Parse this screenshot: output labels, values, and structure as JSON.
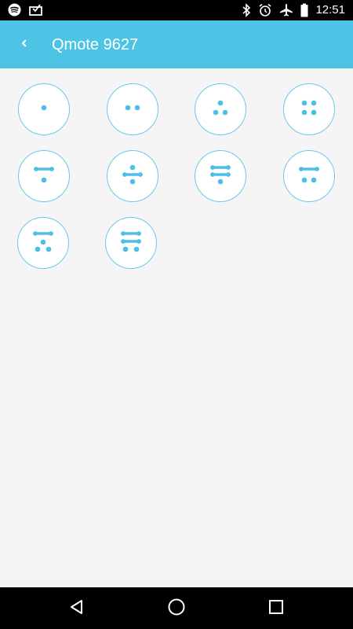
{
  "status_bar": {
    "time": "12:51",
    "left_icons": [
      "spotify-icon",
      "inbox-check-icon"
    ],
    "right_icons": [
      "bluetooth-icon",
      "alarm-icon",
      "airplane-mode-icon",
      "battery-icon"
    ]
  },
  "app_bar": {
    "title": "Qmote 9627",
    "back_icon": "chevron-left-icon"
  },
  "colors": {
    "status_bar": "#000000",
    "app_bar": "#4dc3e6",
    "accent": "#4dbfe6",
    "background": "#f5f5f5",
    "nav_bar": "#000000"
  },
  "commands": [
    {
      "pattern": ".",
      "icon": "one-dot-icon"
    },
    {
      "pattern": "..",
      "icon": "two-dots-icon"
    },
    {
      "pattern": "...",
      "icon": "three-dots-icon"
    },
    {
      "pattern": "....",
      "icon": "four-dots-icon"
    },
    {
      "pattern": "-.",
      "icon": "dash-dot-icon"
    },
    {
      "pattern": ".-.",
      "icon": "dot-dash-dot-icon"
    },
    {
      "pattern": "--.",
      "icon": "dash-dash-dot-icon"
    },
    {
      "pattern": "-..",
      "icon": "dash-two-dots-icon"
    },
    {
      "pattern": "-...",
      "icon": "dash-three-dots-icon"
    },
    {
      "pattern": "-..-",
      "icon": "dash-dots-dash-icon"
    }
  ],
  "nav_bar": {
    "icons": [
      "back-triangle-icon",
      "home-circle-icon",
      "recents-square-icon"
    ]
  }
}
